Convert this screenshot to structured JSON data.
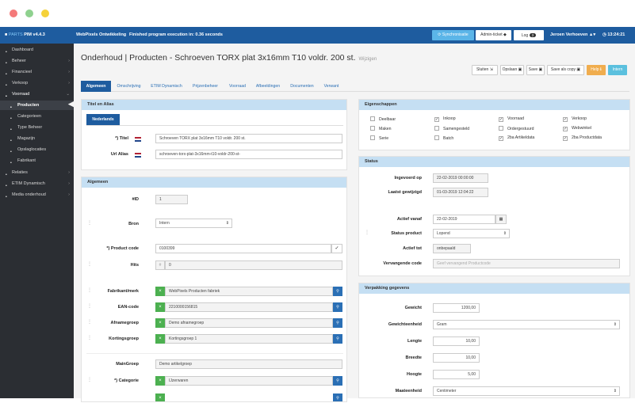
{
  "window": {
    "dot_colors": [
      "#f47a7a",
      "#8fd18f",
      "#f5d23a"
    ]
  },
  "topbar": {
    "logo": "PARTS",
    "version": "PIM v4.4.3",
    "company": "WebPixels Ontwikkeling",
    "execution": "Finished program execution in: 0.36 seconds",
    "sync_label": "Synchronisatie",
    "admin_ticket_label": "Admin-ticket",
    "log_label": "Log",
    "log_count": "3",
    "user": "Jeroen Verhoeven",
    "time": "13:24:21",
    "accent": "#1e5c9f"
  },
  "sidebar": {
    "items": [
      {
        "label": "Dashboard",
        "icon": "dashboard-icon"
      },
      {
        "label": "Beheer",
        "icon": "settings-icon"
      },
      {
        "label": "Financieel",
        "icon": "money-icon"
      },
      {
        "label": "Verkoop",
        "icon": "cart-icon"
      },
      {
        "label": "Voorraad",
        "icon": "box-icon"
      },
      {
        "label": "Producten",
        "icon": "product-icon"
      },
      {
        "label": "Categorieen",
        "icon": "category-icon"
      },
      {
        "label": "Type Beheer",
        "icon": "type-icon"
      },
      {
        "label": "Magazijn",
        "icon": "warehouse-icon"
      },
      {
        "label": "Opslaglocaties",
        "icon": "location-icon"
      },
      {
        "label": "Fabrikant",
        "icon": "factory-icon"
      },
      {
        "label": "Relaties",
        "icon": "relations-icon"
      },
      {
        "label": "ETIM Dynamisch",
        "icon": "etim-icon"
      },
      {
        "label": "Media onderhoud",
        "icon": "media-icon"
      }
    ]
  },
  "page": {
    "title": "Onderhoud | Producten - Schroeven TORX plat 3x16mm T10 voldr. 200 st.",
    "subtitle": "Wijzigen"
  },
  "actions": {
    "sluiten": "Sluiten",
    "opslaan": "Opslaan",
    "save": "Save",
    "save_copy": "Save als copy",
    "help": "Help",
    "intern": "Intern"
  },
  "tabs": [
    "Algemeen",
    "Omschrijving",
    "ETIM Dynamisch",
    "Prijzenbeheer",
    "Voorraad",
    "Afbeeldingen",
    "Documenten",
    "Verwant"
  ],
  "titel_alias": {
    "header": "Titel en Alias",
    "lang_tab": "Nederlands",
    "titel_label": "*) Titel",
    "titel_value": "Schroeven TORX plat 3x16mm T10 voldr. 200 st.",
    "url_label": "Url Alias",
    "url_value": "schroeven-torx-plat-3x16mm-t10-voldr-200-st-"
  },
  "algemeen": {
    "header": "Algemeen",
    "id_label": "#ID",
    "id_value": "1",
    "bron_label": "Bron",
    "bron_value": "Intern",
    "productcode_label": "*) Product code",
    "productcode_value": "0100399",
    "hits_label": "Hits",
    "hits_value": "0",
    "fabrikant_label": "Fabrikant/merk",
    "fabrikant_value": "WebPixels Producten fabriek",
    "ean_label": "EAN-code",
    "ean_value": "2210000156815",
    "afname_label": "Afnamegroep",
    "afname_value": "Demo afnamegroep",
    "korting_label": "Kortingsgroep",
    "korting_value": "Kortingsgroep 1",
    "maingroep_label": "MainGroep",
    "maingroep_value": "Demo artikelgroep",
    "categorie_label": "*) Categorie",
    "categorie_value": "IJzerwaren"
  },
  "eigenschappen": {
    "header": "Eigenschappen",
    "items": [
      {
        "label": "Deelbaar",
        "checked": false
      },
      {
        "label": "Inkoop",
        "checked": true
      },
      {
        "label": "Voorraad",
        "checked": true
      },
      {
        "label": "Verkoop",
        "checked": true
      },
      {
        "label": "Maken",
        "checked": false
      },
      {
        "label": "Samengesteld",
        "checked": false
      },
      {
        "label": "Ordergestuurd",
        "checked": false
      },
      {
        "label": "Webwinkel",
        "checked": true
      },
      {
        "label": "Serie",
        "checked": false
      },
      {
        "label": "Batch",
        "checked": false
      },
      {
        "label": "2ba Artikeldata",
        "checked": true
      },
      {
        "label": "2ba Productdata",
        "checked": true
      }
    ]
  },
  "status": {
    "header": "Status",
    "ingevoerd_label": "Ingevoerd op",
    "ingevoerd_value": "22-02-2019 00:00:00",
    "gewijzigd_label": "Laatst gewijzigd",
    "gewijzigd_value": "01-03-2019 12:04:22",
    "actief_vanaf_label": "Actief vanaf",
    "actief_vanaf_value": "22-02-2019",
    "status_product_label": "Status product",
    "status_product_value": "Lopend",
    "actief_tot_label": "Actief tot",
    "actief_tot_value": "onbepaald",
    "vervangende_label": "Vervangende code",
    "vervangende_placeholder": "Geef vervangend Productcode"
  },
  "verpakking": {
    "header": "Verpakking gegevens",
    "gewicht_label": "Gewicht",
    "gewicht_value": "1200,00",
    "gewichteenheid_label": "Gewichteenheid",
    "gewichteenheid_value": "Gram",
    "lengte_label": "Lengte",
    "lengte_value": "10,00",
    "breedte_label": "Breedte",
    "breedte_value": "10,00",
    "hoogte_label": "Hoogte",
    "hoogte_value": "5,00",
    "maateenheid_label": "Maateenheid",
    "maateenheid_value": "Centimeter"
  }
}
